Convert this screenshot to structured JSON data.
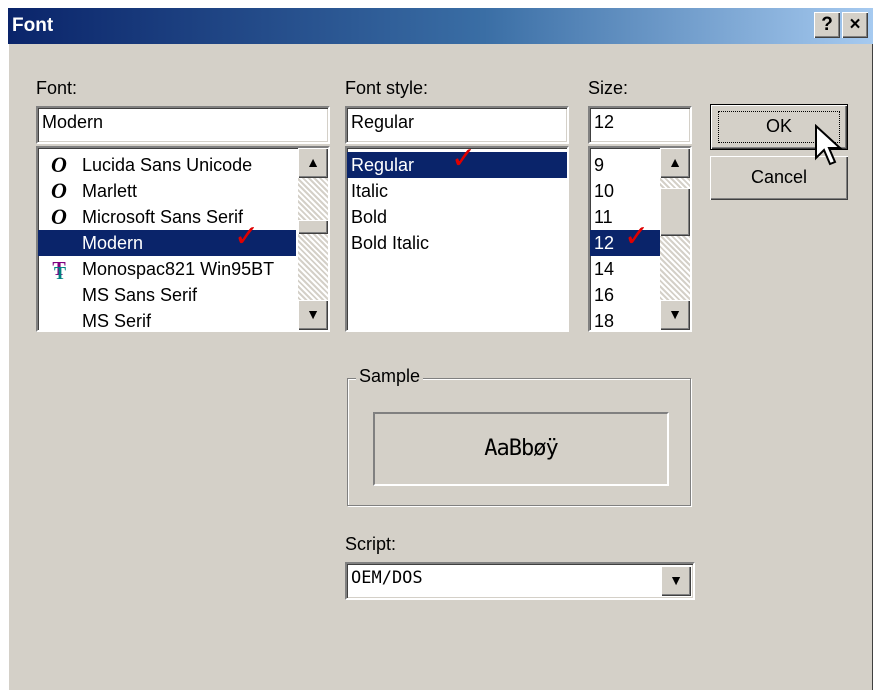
{
  "dialog": {
    "title": "Font",
    "help_label": "?",
    "close_label": "×"
  },
  "font": {
    "label": "Font:",
    "value": "Modern",
    "items": [
      {
        "label": "Lucida Sans Unicode",
        "icon": "opentype-icon"
      },
      {
        "label": "Marlett",
        "icon": "opentype-icon"
      },
      {
        "label": "Microsoft Sans Serif",
        "icon": "opentype-icon"
      },
      {
        "label": "Modern",
        "icon": "none",
        "selected": true
      },
      {
        "label": "Monospac821 Win95BT",
        "icon": "truetype-icon"
      },
      {
        "label": "MS Sans Serif",
        "icon": "none"
      },
      {
        "label": "MS Serif",
        "icon": "none"
      }
    ]
  },
  "style": {
    "label": "Font style:",
    "value": "Regular",
    "items": [
      "Regular",
      "Italic",
      "Bold",
      "Bold Italic"
    ]
  },
  "size": {
    "label": "Size:",
    "value": "12",
    "items": [
      "9",
      "10",
      "11",
      "12",
      "14",
      "16",
      "18"
    ]
  },
  "buttons": {
    "ok": "OK",
    "cancel": "Cancel"
  },
  "sample": {
    "label": "Sample",
    "text": "AaBbøÿ"
  },
  "script": {
    "label": "Script:",
    "value": "OEM/DOS"
  },
  "icons": {
    "check": "red-checkmark-icon",
    "cursor": "mouse-pointer-icon"
  },
  "colors": {
    "titlebar": "#0a246a",
    "selection": "#0a246a",
    "check": "#e00000",
    "face": "#d4d0c8"
  }
}
